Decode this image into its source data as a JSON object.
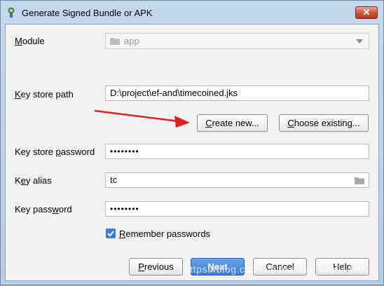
{
  "window": {
    "title": "Generate Signed Bundle or APK",
    "close_label": "✕"
  },
  "module": {
    "label_prefix": "",
    "label_mnemonic": "M",
    "label_rest": "odule",
    "value": "app"
  },
  "key_store_path": {
    "label_mnemonic": "K",
    "label_rest": "ey store path",
    "value": "D:\\project\\ef-and\\timecoined.jks"
  },
  "buttons": {
    "create_new_mnemonic": "C",
    "create_new_rest": "reate new...",
    "choose_existing_mnemonic": "C",
    "choose_existing_rest": "hoose existing...",
    "previous_mnemonic": "P",
    "previous_rest": "revious",
    "next_mnemonic": "N",
    "next_rest": "ext",
    "cancel": "Cancel",
    "help": "Help"
  },
  "key_store_password": {
    "label_prefix": "Key store ",
    "label_mnemonic": "p",
    "label_rest": "assword",
    "value": "••••••••"
  },
  "key_alias": {
    "label_prefix": "K",
    "label_mnemonic": "e",
    "label_rest": "y alias",
    "value": "tc"
  },
  "key_password": {
    "label_prefix": "Key pass",
    "label_mnemonic": "w",
    "label_rest": "ord",
    "value": "••••••••"
  },
  "remember": {
    "label_mnemonic": "R",
    "label_rest": "emember passwords",
    "checked": true
  },
  "watermark": "https://blog.csdn.net/weixin_44904490",
  "colors": {
    "accent": "#3d7bd0",
    "arrow": "#e02020"
  }
}
